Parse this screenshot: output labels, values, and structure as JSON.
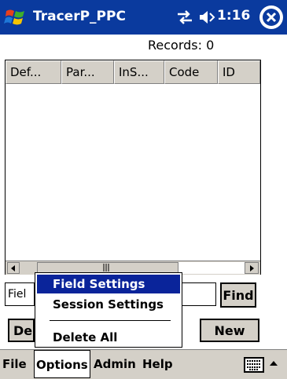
{
  "title_bar": {
    "app_title": "TracerP_PPC",
    "clock": "1:16"
  },
  "records_label": "Records:  0",
  "list": {
    "columns": [
      "Def...",
      "Par...",
      "InS...",
      "Code",
      "ID"
    ]
  },
  "field_input_value": "Fiel",
  "buttons": {
    "find": "Find",
    "new": "New",
    "d_partial": "De"
  },
  "options_menu": {
    "items": [
      "Field Settings",
      "Session Settings",
      "Delete All"
    ],
    "selected": "Field Settings"
  },
  "menubar": {
    "items": [
      "File",
      "Options",
      "Admin",
      "Help"
    ]
  },
  "colors": {
    "title_bar": "#0a3a9e",
    "selection": "#0a249a",
    "chrome": "#d4d0c8"
  }
}
